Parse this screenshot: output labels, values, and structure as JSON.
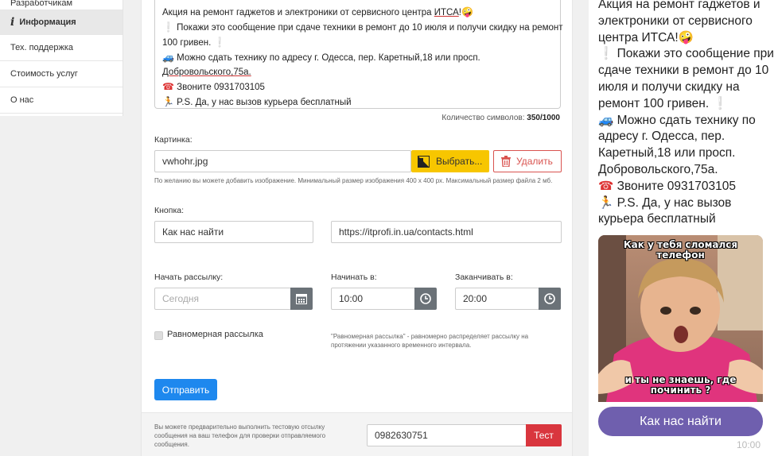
{
  "sidebar": {
    "items": [
      {
        "label": "Разработчикам"
      },
      {
        "label": "Информация"
      },
      {
        "label": "Тех. поддержка"
      },
      {
        "label": "Стоимость услуг"
      },
      {
        "label": "О нас"
      }
    ]
  },
  "message": {
    "line1": "Акция на ремонт гаджетов и электроники от сервисного центра ",
    "line1_brand": "ИТСА",
    "line1_end": "!",
    "line2": " Покажи это сообщение при сдаче техники в ремонт до 10 июля и получи скидку на ремонт",
    "line3": "100 гривен. ",
    "line4": " Можно сдать технику по адресу г. Одесса, пер. Каретный,18 или просп.",
    "line5": "Добровольского,75а.",
    "line6": " Звоните 0931703105",
    "line7": " P.S. Да, у нас вызов курьера бесплатный",
    "counter_label": "Количество символов: ",
    "counter_current": "350",
    "counter_max": "/1000"
  },
  "image_field": {
    "label": "Картинка:",
    "value": "vwhohr.jpg",
    "choose_label": "Выбрать...",
    "delete_label": "Удалить",
    "hint": "По желанию вы можете добавить изображение. Минимальный размер изображения 400 х 400 px. Максимальный размер файла 2 мб."
  },
  "button_field": {
    "label": "Кнопка:",
    "text_value": "Как нас найти",
    "url_value": "https://itprofi.in.ua/contacts.html"
  },
  "schedule": {
    "start_label": "Начать рассылку:",
    "start_placeholder": "Сегодня",
    "from_label": "Начинать в:",
    "from_value": "10:00",
    "to_label": "Заканчивать в:",
    "to_value": "20:00"
  },
  "uniform": {
    "label": "Равномерная рассылка",
    "hint": "\"Равномерная рассылка\" - равномерно распределяет рассылку на протяжении указанного временного интервала."
  },
  "send_label": "Отправить",
  "test": {
    "hint": "Вы можете предварительно выполнить тестовую отсылку сообщения на ваш телефон для проверки отправляемого сообщения.",
    "phone": "0982630751",
    "button": "Тест"
  },
  "preview": {
    "p1": "Акция на ремонт гаджетов и электроники от сервисного центра ИТСА!",
    "p2": " Покажи это сообщение при сдаче техники в ремонт до 10 июля и получи скидку на ремонт 100 гривен. ",
    "p3": " Можно сдать технику по адресу г. Одесса, пер. Каретный,18 или просп. Добровольского,75а.",
    "p4": " Звоните 0931703105",
    "p5": " P.S. Да, у нас вызов курьера бесплатный",
    "meme_top": "Как у тебя сломался телефон",
    "meme_bottom": "и ты не знаешь, где починить ?",
    "button": "Как нас найти",
    "time": "10:00"
  },
  "colors": {
    "accent_blue": "#1e88ee",
    "yellow": "#f7c600",
    "danger": "#d9363e",
    "viber_purple": "#6f5fae"
  }
}
